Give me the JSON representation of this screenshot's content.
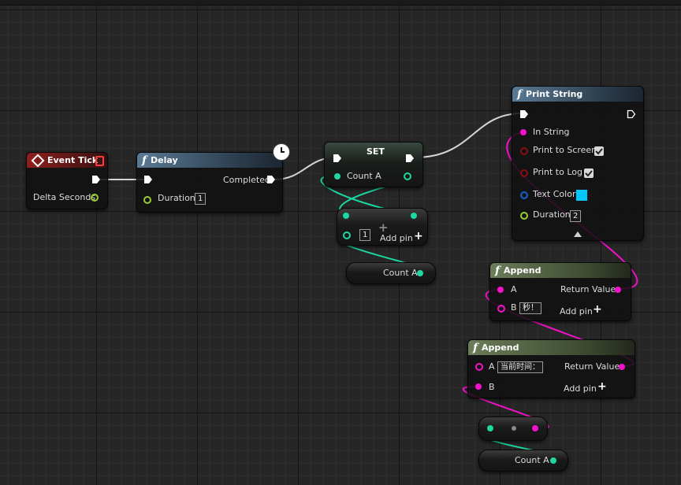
{
  "nodes": {
    "event_tick": {
      "title": "Event Tick",
      "delta": "Delta Seconds"
    },
    "delay": {
      "symbol": "f",
      "title": "Delay",
      "completed": "Completed",
      "duration": "Duration",
      "duration_value": "1"
    },
    "set": {
      "title": "SET",
      "count": "Count A"
    },
    "add_node": {
      "value": "1",
      "add_pin": "Add pin"
    },
    "get_count_1": {
      "label": "Count A"
    },
    "print_string": {
      "symbol": "f",
      "title": "Print String",
      "in_string": "In String",
      "print_to_screen": "Print to Screen",
      "print_to_log": "Print to Log",
      "text_color": "Text Color",
      "duration": "Duration",
      "duration_value": "2"
    },
    "append_1": {
      "symbol": "f",
      "title": "Append",
      "a": "A",
      "b": "B",
      "b_value": "秒！",
      "return": "Return Value",
      "add_pin": "Add pin"
    },
    "append_2": {
      "symbol": "f",
      "title": "Append",
      "a": "A",
      "a_value": "当前时间：",
      "b": "B",
      "return": "Return Value",
      "add_pin": "Add pin"
    },
    "get_count_2": {
      "label": "Count A"
    }
  },
  "colors": {
    "exec": "#ffffff",
    "float": "#9acd32",
    "integer": "#1dd8a2",
    "string": "#f312c9",
    "linear_color": "#1560c9",
    "bool": "#8a0f0f",
    "text_color_swatch": "#00c8ff"
  },
  "icons": [
    "event-diamond-icon",
    "function-icon",
    "clock-icon",
    "plus-icon",
    "collapse-arrow-icon",
    "checkbox-icon"
  ]
}
